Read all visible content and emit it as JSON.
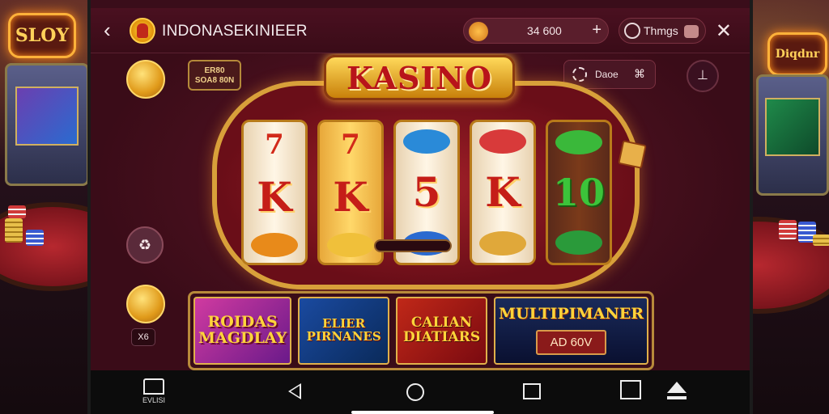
{
  "background": {
    "neon_left": "SLOY",
    "neon_right": "Diqdnr"
  },
  "topbar": {
    "title": "INDONASEKINIEER",
    "balance_value": "34 600",
    "balance_add": "+",
    "things_label": "Thmgs",
    "close": "✕",
    "back": "‹"
  },
  "side": {
    "promo_tag": "ER80\nSOA8 80N",
    "bubble": "♻",
    "x_chip": "X6"
  },
  "right": {
    "pill_label": "Daoe",
    "pill_x": "⌘",
    "round_icon": "⊥"
  },
  "slot": {
    "sign": "KASINO",
    "reels": [
      {
        "top": "7",
        "mid": "K",
        "style": "white"
      },
      {
        "top": "7",
        "mid": "K",
        "style": "gold"
      },
      {
        "top": "",
        "mid": "5",
        "style": "white"
      },
      {
        "top": "",
        "mid": "K",
        "style": "white"
      },
      {
        "top": "",
        "mid": "10",
        "style": "dark"
      }
    ]
  },
  "cards": [
    {
      "title": "ROIDAS MAGDLAY"
    },
    {
      "title": "ELIER PIRNANES"
    },
    {
      "title": "CALIAN DIATIARS"
    },
    {
      "title": "MULTIPIMANER",
      "button": "AD 60V"
    }
  ],
  "nav": {
    "home_label": "EVLISI"
  },
  "colors": {
    "accent_gold": "#ffd43a",
    "frame_red": "#3a0d1a",
    "sign_red": "#b8141a"
  }
}
